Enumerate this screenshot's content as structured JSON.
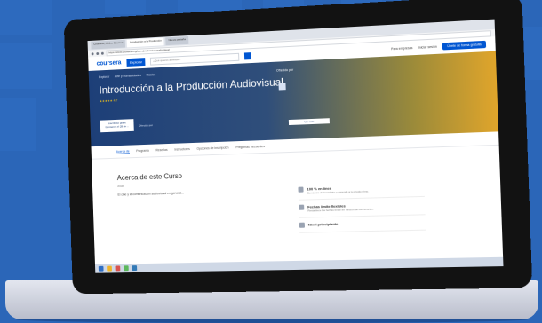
{
  "browser": {
    "tabs": [
      "Coursera | Online Courses",
      "Introducción a la Producción",
      "Nueva pestaña"
    ],
    "url": "https://www.coursera.org/learn/produccion-audiovisual"
  },
  "topnav": {
    "logo": "coursera",
    "explore": "Explorar",
    "search_placeholder": "¿Qué quieres aprender?",
    "links": [
      "Para empresas",
      "Iniciar sesión"
    ],
    "join": "Únete de forma gratuita"
  },
  "hero": {
    "crumbs": [
      "Explorar",
      "Arte y Humanidades",
      "Música"
    ],
    "title": "Introducción a la Producción Audiovisual",
    "rating": "★★★★★ 4.7",
    "enroll": "Inscríbete gratis",
    "enroll_sub": "Comienza el 28 de ...",
    "offered_by": "Ofrecido por",
    "view_btn": "Ver más"
  },
  "subtabs": [
    "Acerca de",
    "Programa",
    "Reseñas",
    "Instructores",
    "Opciones de inscripción",
    "Preguntas frecuentes"
  ],
  "content": {
    "about_title": "Acerca de este Curso",
    "views": "vistas",
    "description": "El cine y la comunicación audiovisual en general..."
  },
  "features": [
    {
      "title": "100 % en línea",
      "sub": "Comienza de inmediato y aprende a tu propio ritmo."
    },
    {
      "title": "Fechas límite flexibles",
      "sub": "Restablece las fechas límite en función de tus horarios."
    },
    {
      "title": "Nivel principiante",
      "sub": ""
    }
  ],
  "colors": {
    "background": "#2b66b8",
    "brand": "#0056d2",
    "hero_start": "#1d3f78",
    "hero_end": "#e0a52b"
  }
}
